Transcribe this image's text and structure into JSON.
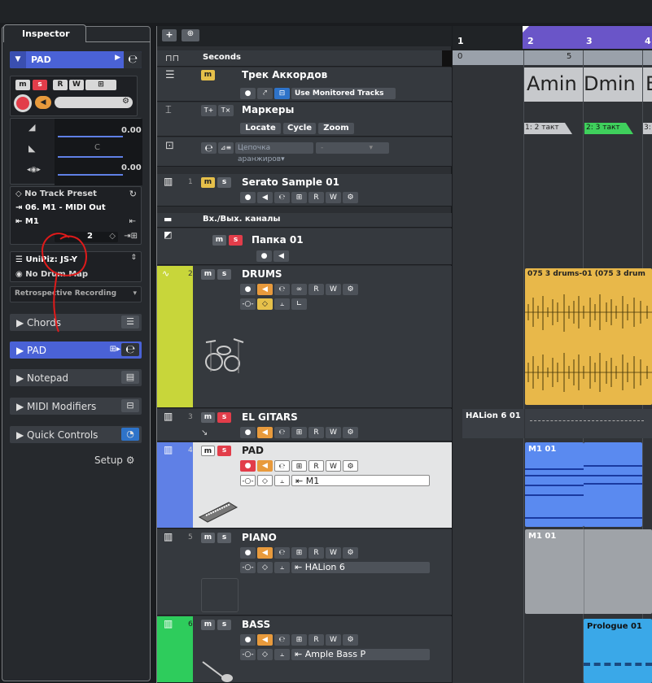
{
  "inspector": {
    "tab_label": "Inspector",
    "track_name": "PAD",
    "vol_value": "0.00",
    "pan_value": "C",
    "delay_value": "0.00",
    "track_preset": "No Track Preset",
    "midi_out": "06. M1 - MIDI Out",
    "output": "M1",
    "channel": "2",
    "map": "UniPiz: JS-Y",
    "drum_map": "No Drum Map",
    "retro": "Retrospective Recording",
    "sections": [
      "Chords",
      "PAD",
      "Notepad",
      "MIDI Modifiers",
      "Quick Controls"
    ],
    "setup_label": "Setup"
  },
  "tracklist": {
    "ruler_track": "Seconds",
    "chord_track": "Трек Аккордов",
    "use_monitored": "Use Monitored Tracks",
    "marker_track": "Маркеры",
    "marker_btns": [
      "Locate",
      "Cycle",
      "Zoom"
    ],
    "arranger_name": "Цепочка аранжиров",
    "arranger_dots": "-",
    "serato": "Serato Sample 01",
    "io_folder": "Вх./Вых. каналы",
    "folder": "Папка 01",
    "drums": "DRUMS",
    "el_gitars": "EL GITARS",
    "pad": "PAD",
    "pad_output": "M1",
    "piano": "PIANO",
    "piano_output": "HALion 6",
    "bass": "BASS",
    "bass_output": "Ample Bass P",
    "track_numbers": [
      "1",
      "2",
      "3",
      "4",
      "5",
      "6"
    ]
  },
  "arranger": {
    "bars": [
      "1",
      "2",
      "3",
      "4"
    ],
    "time_zero": "0",
    "time_five": "5",
    "chords": [
      "Amin",
      "Dmin",
      "E"
    ],
    "markers": [
      "1: 2 такт",
      "2: 3 такт",
      "3:"
    ],
    "drum_clip": "075 3 drums-01 (075 3 drum",
    "halion_label": "HALion 6 01",
    "pad_clip": "M1 01",
    "piano_clip": "M1 01",
    "bass_clip": "Prologue 01"
  },
  "colors": {
    "accent": "#4a62d6",
    "drums": "#c8d63a",
    "pad": "#5f80e6",
    "bass": "#2ecc5c",
    "drum_clip": "#e8b84a"
  }
}
